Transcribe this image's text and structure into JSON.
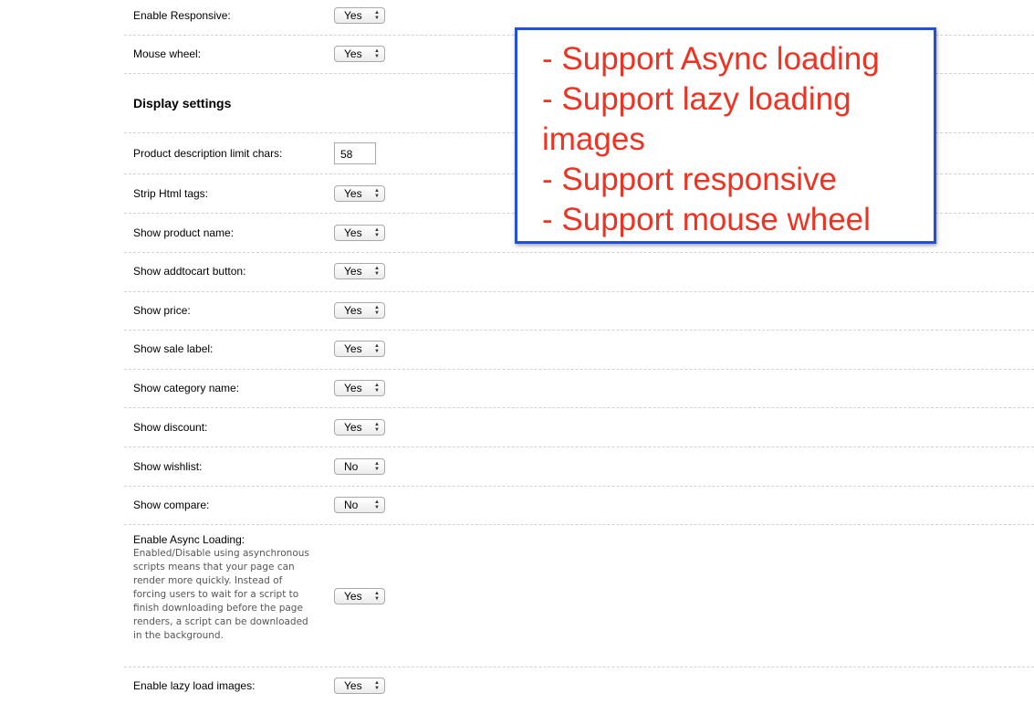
{
  "settings": {
    "enable_responsive": {
      "label": "Enable Responsive:",
      "value": "Yes"
    },
    "mouse_wheel": {
      "label": "Mouse wheel:",
      "value": "Yes"
    },
    "display_heading": "Display settings",
    "product_desc_limit": {
      "label": "Product description limit chars:",
      "value": "58"
    },
    "strip_html": {
      "label": "Strip Html tags:",
      "value": "Yes"
    },
    "show_product_name": {
      "label": "Show product name:",
      "value": "Yes"
    },
    "show_addtocart": {
      "label": "Show addtocart button:",
      "value": "Yes"
    },
    "show_price": {
      "label": "Show price:",
      "value": "Yes"
    },
    "show_sale_label": {
      "label": "Show sale label:",
      "value": "Yes"
    },
    "show_category_name": {
      "label": "Show category name:",
      "value": "Yes"
    },
    "show_discount": {
      "label": "Show discount:",
      "value": "Yes"
    },
    "show_wishlist": {
      "label": "Show wishlist:",
      "value": "No"
    },
    "show_compare": {
      "label": "Show compare:",
      "value": "No"
    },
    "async_loading": {
      "label": "Enable Async Loading:",
      "description": "Enabled/Disable using asynchronous scripts means that your page can render more quickly. Instead of forcing users to wait for a script to finish downloading before the page renders, a script can be downloaded in the background.",
      "value": "Yes"
    },
    "lazy_load": {
      "label": "Enable lazy load images:",
      "value": "Yes"
    }
  },
  "callout": {
    "lines": [
      "- Support Async loading",
      "- Support lazy loading images",
      "- Support responsive",
      "- Support mouse wheel"
    ]
  },
  "icons": {
    "select_arrows": "up-down-arrows-icon"
  }
}
